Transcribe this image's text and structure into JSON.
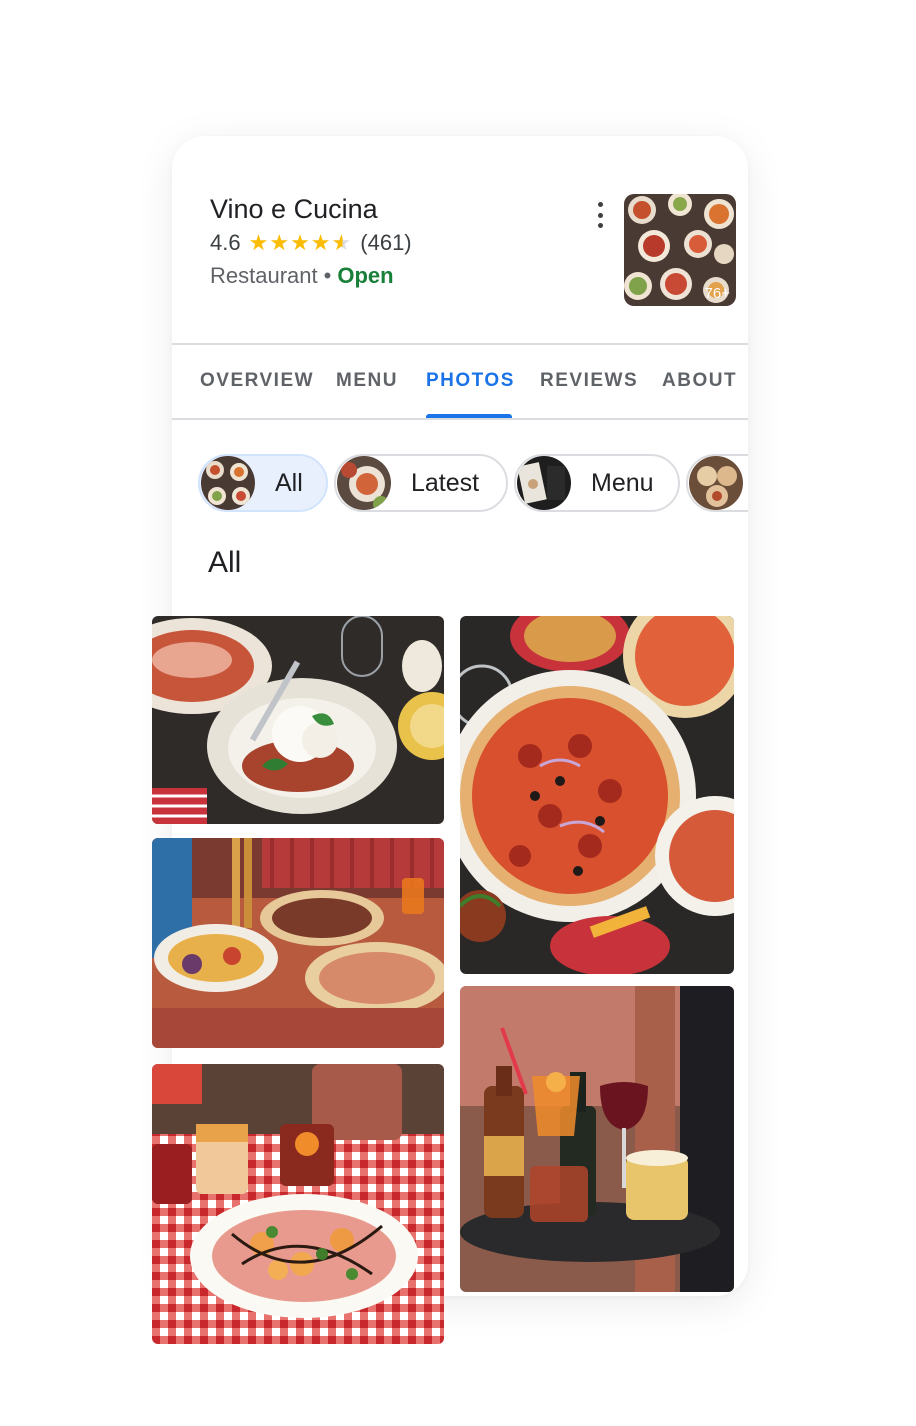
{
  "business": {
    "name": "Vino e Cucina",
    "rating": "4.6",
    "stars_filled": 4.5,
    "reviews_count": "(461)",
    "category": "Restaurant",
    "separator": "•",
    "status": "Open",
    "thumbnail_count": "76+"
  },
  "tabs": [
    {
      "label": "OVERVIEW"
    },
    {
      "label": "MENU"
    },
    {
      "label": "PHOTOS",
      "active": true
    },
    {
      "label": "REVIEWS"
    },
    {
      "label": "ABOUT"
    }
  ],
  "chips": [
    {
      "label": "All",
      "active": true
    },
    {
      "label": "Latest"
    },
    {
      "label": "Menu"
    },
    {
      "label": ""
    }
  ],
  "section_title": "All",
  "colors": {
    "accent": "#1a73e8",
    "open": "#188038",
    "star": "#fbbc04"
  }
}
